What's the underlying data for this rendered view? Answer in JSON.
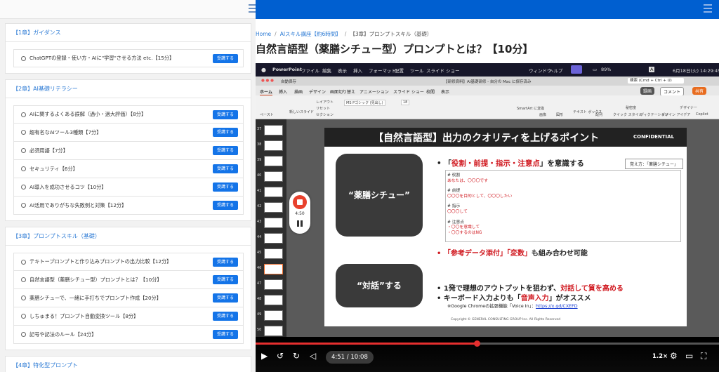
{
  "colors": {
    "accent": "#1474e8",
    "topbar": "#005fd0",
    "link": "#2d7bd5",
    "highlight": "#d0181f"
  },
  "sidebar": {
    "sections": [
      {
        "title": "【1章】ガイダンス",
        "lessons": [
          {
            "title": "ChatGPTの登録・使い方・AIに\"学習\"させる方法 etc.【15分】",
            "button": "受講する"
          }
        ]
      },
      {
        "title": "【2章】AI基礎リテラシー",
        "lessons": [
          {
            "title": "AIに関するよくある誤解（過小・過大評価）【8分】",
            "button": "受講する"
          },
          {
            "title": "超有名なAIツール3種類【7分】",
            "button": "受講する"
          },
          {
            "title": "必須用語【7分】",
            "button": "受講する"
          },
          {
            "title": "セキュリティ【6分】",
            "button": "受講する"
          },
          {
            "title": "AI導入を成功させるコツ【10分】",
            "button": "受講する"
          },
          {
            "title": "AI活用でありがちな失敗例と対策【12分】",
            "button": "受講する"
          }
        ]
      },
      {
        "title": "【3章】プロンプトスキル（基礎）",
        "lessons": [
          {
            "title": "テキトープロンプトと作り込みプロンプトの出力比較【12分】",
            "button": "受講する"
          },
          {
            "title": "自然言語型（薬膳シチュー型）プロンプトとは？【10分】",
            "button": "受講する"
          },
          {
            "title": "薬膳シチューで、一緒に手打ちでプロンプト作成【20分】",
            "button": "受講する"
          },
          {
            "title": "しちゅまる！プロンプト自動変換ツール【8分】",
            "button": "受講する"
          },
          {
            "title": "記号や記法のルール【24分】",
            "button": "受講する"
          }
        ]
      },
      {
        "title": "【4章】特化型プロンプト",
        "lessons": []
      }
    ]
  },
  "breadcrumb": {
    "home": "Home",
    "course": "AIスキル講座【約6時間】",
    "chapter": "【3章】プロンプトスキル（基礎）",
    "sep": "/"
  },
  "page_title": "自然言語型（薬膳シチュー型）プロンプトとは？【10分】",
  "video": {
    "menubar": {
      "app": "PowerPoint",
      "file": "ファイル",
      "edit": "編集",
      "view": "表示",
      "insert": "挿入",
      "format": "フォーマット",
      "arrange": "配置",
      "tools": "ツール",
      "slideshow": "スライド ショー",
      "window": "ウィンドウ",
      "help": "ヘルプ",
      "battery": "89%",
      "input": "A",
      "clock": "6月18日(火) 14:29:45"
    },
    "ppt": {
      "autosave": "自動保存",
      "doc": "【研修資料】AI基礎研修 - 自分の Mac に保存済み",
      "search": "検索 (Cmd + Ctrl + U)",
      "tabs": [
        "ホーム",
        "挿入",
        "描画",
        "デザイン",
        "画面切り替え",
        "アニメーション",
        "スライド ショー",
        "校閲",
        "表示"
      ],
      "record": "録画",
      "comment": "コメント",
      "share": "共有",
      "ribbon": {
        "paste": "ペースト",
        "newslide": "新しいスライド",
        "layout": "レイアウト",
        "reset": "リセット",
        "section": "セクション",
        "font": "MS Pゴシック (見出し)",
        "size": "18",
        "smartart": "SmartArt に変換",
        "image": "画像",
        "shape": "図形",
        "textbox": "テキスト ボックス",
        "arrange": "配列",
        "quickstyle": "クイック スタイル",
        "dictate": "ディクテーション",
        "designer": "デザイン アイデア",
        "copilot": "Copilot",
        "designerapp": "デザイナー",
        "sensitivity": "秘密度"
      }
    },
    "thumb_numbers": [
      "37",
      "38",
      "39",
      "40",
      "41",
      "42",
      "43",
      "44",
      "45",
      "46",
      "47",
      "48",
      "49",
      "50"
    ],
    "selected_thumb": "46",
    "recorder_time": "4:50",
    "slide": {
      "title": "【自然言語型】出力のクオリティを上げるポイント",
      "confidential": "CONFIDENTIAL",
      "pill1": "“薬膳シチュー”",
      "pill2": "“対話”する",
      "b1_pre": "「",
      "b1_hl": "役割・前提・指示・注意点",
      "b1_post": "」を意識する",
      "badge": "覚え方：「薬膳シチュー」",
      "box": {
        "h1": "# 役割",
        "v1": "あなたは、〇〇〇です",
        "h2": "# 前提",
        "v2": "〇〇〇を目的として、〇〇〇したい",
        "h3": "# 指示",
        "v3": "〇〇〇して",
        "h4": "# 注意点",
        "v4a": "・〇〇を意識して",
        "v4b": "・〇〇するのはNG"
      },
      "b2_q1": "「参考データ添付」",
      "b2_q2": "「変数」",
      "b2_post": "も組み合わせ可能",
      "b3_pre": "1発で理想のアウトプットを狙わず、",
      "b3_hl": "対話して質を高める",
      "b4_pre": "キーボード入力よりも「",
      "b4_hl": "音声入力",
      "b4_post": "」がオススメ",
      "note": "※Google Chromeの拡張機能「Voice In」：",
      "note_link": "https://x.gd/CXEFD",
      "copyright": "Copyright © GENERAL CONSULTING GROUP Inc. All Rights Reserved"
    },
    "player": {
      "time": "4:51 / 10:08",
      "speed": "1.2×",
      "progress": 0.478
    }
  }
}
